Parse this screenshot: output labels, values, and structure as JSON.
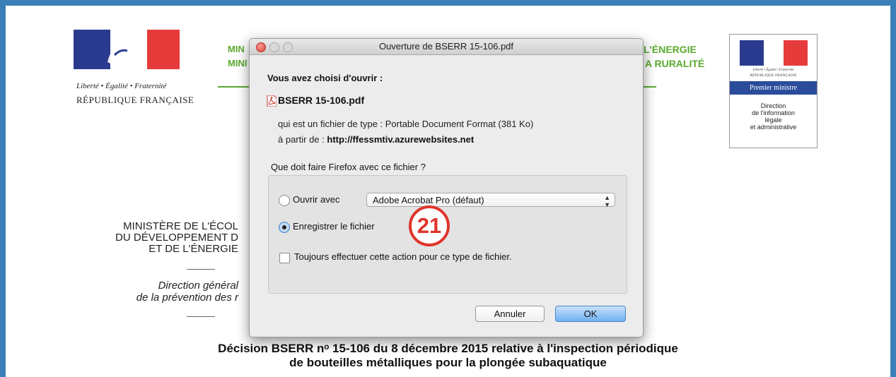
{
  "background_page": {
    "motto": "Liberté • Égalité • Fraternité",
    "republique": "RÉPUBLIQUE FRANÇAISE",
    "header_left_partial": [
      "MIN",
      "MINI"
    ],
    "header_right_partial": [
      "L'ÉNERGIE",
      "A RURALITÉ"
    ],
    "ministry_lines": [
      "MINISTÈRE DE L'ÉCOL",
      "DU DÉVELOPPEMENT D",
      "ET DE L'ÉNERGIE"
    ],
    "direction_lines": [
      "Direction général",
      "de la prévention des r"
    ],
    "decision_title": [
      "Décision BSERR nᵒ 15-106 du 8 décembre 2015 relative à l'inspection périodique",
      "de bouteilles métalliques pour la plongée subaquatique"
    ],
    "pm_logo": {
      "motto": "Liberté • Égalité • Fraternité",
      "republique": "RÉPUBLIQUE FRANÇAISE",
      "bar": "Premier ministre",
      "direction": [
        "Direction",
        "de l'information",
        "légale",
        "et administrative"
      ]
    }
  },
  "dialog": {
    "title": "Ouverture de BSERR 15-106.pdf",
    "heading": "Vous avez choisi d'ouvrir :",
    "filename": "BSERR 15-106.pdf",
    "type_line": "qui est un fichier de type : Portable Document Format (381 Ko)",
    "from_prefix": "à partir de : ",
    "from_url": "http://ffessmtiv.azurewebsites.net",
    "question": "Que doit faire Firefox avec ce fichier ?",
    "open_with_label": "Ouvrir avec",
    "open_with_selected": "Adobe Acrobat Pro (défaut)",
    "save_label": "Enregistrer le fichier",
    "always_label": "Toujours effectuer cette action pour ce type de fichier.",
    "cancel_label": "Annuler",
    "ok_label": "OK",
    "selected_option": "save",
    "always_checked": false
  },
  "annotation": "21",
  "colors": {
    "outer_frame": "#3a7fb8",
    "ministry_green": "#5aaa2e",
    "annotation_red": "#e0352b",
    "default_button_blue": "#6fb0f0"
  }
}
